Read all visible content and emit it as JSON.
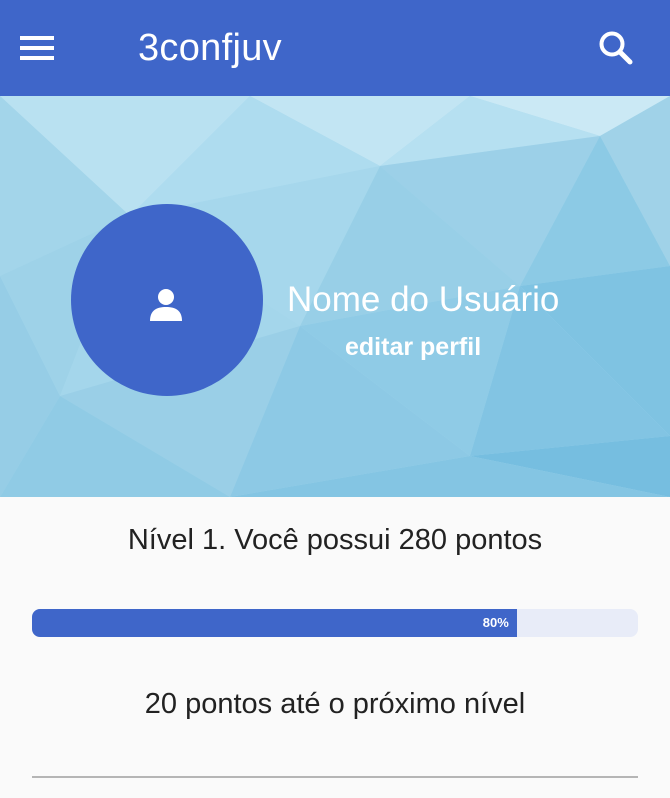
{
  "header": {
    "title": "3confjuv",
    "menu_icon": "hamburger-menu-icon",
    "search_icon": "search-icon",
    "bar_color": "#3f66c9"
  },
  "profile": {
    "avatar_icon": "person-icon",
    "name": "Nome do Usuário",
    "edit_label": "editar perfil"
  },
  "level": {
    "summary": "Nível 1. Você possui 280 pontos",
    "progress_percent": 80,
    "progress_label": "80%",
    "next_level": "20 pontos até o próximo nível"
  }
}
